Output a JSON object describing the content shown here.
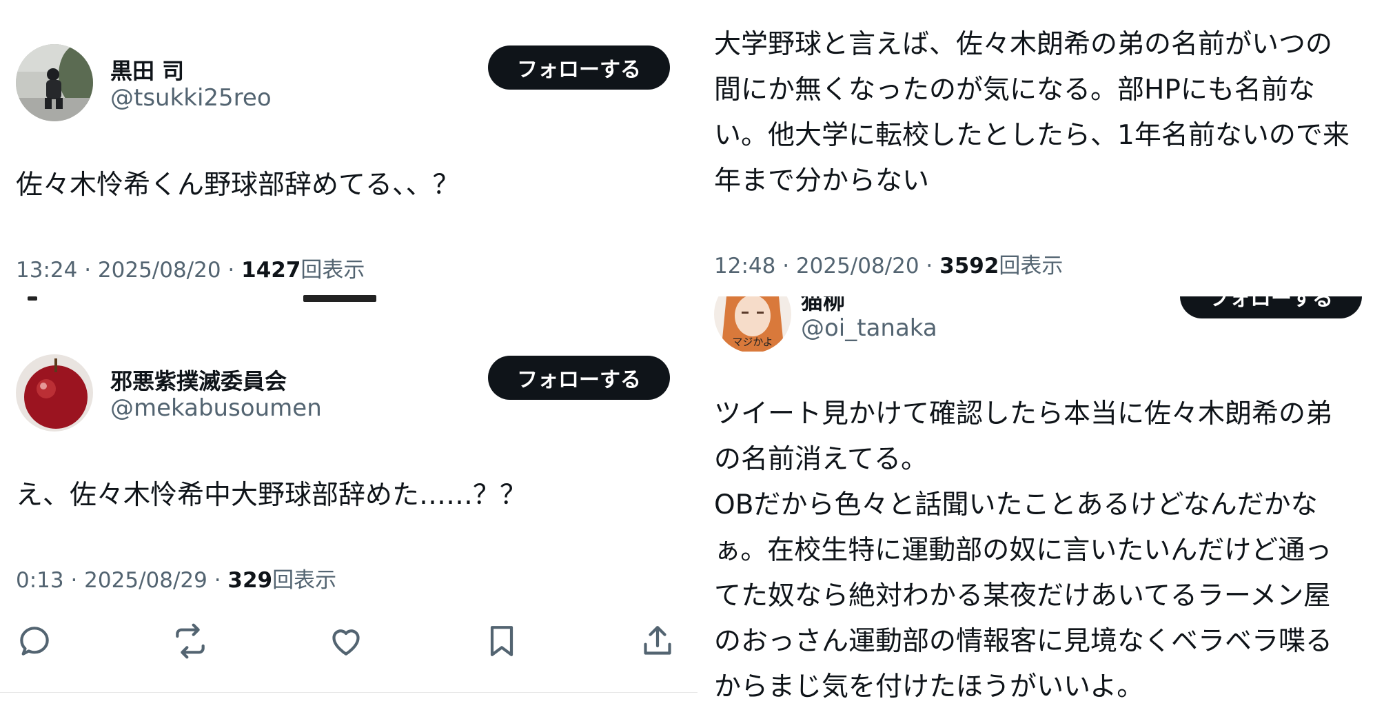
{
  "left": {
    "tweet1": {
      "name": "黒田 司",
      "handle": "@tsukki25reo",
      "follow_label": "フォローする",
      "text": "佐々木怜希くん野球部辞めてる、、？",
      "time": "13:24 · 2025/08/20 · ",
      "views": "1427",
      "views_suffix": "回表示"
    },
    "tweet2": {
      "name": "邪悪紫撲滅委員会",
      "handle": "@mekabusoumen",
      "follow_label": "フォローする",
      "text": "え、佐々木怜希中大野球部辞めた……？？",
      "time": "0:13 · 2025/08/29 · ",
      "views": "329",
      "views_suffix": "回表示"
    },
    "actions": [
      "reply-icon",
      "retweet-icon",
      "like-icon",
      "bookmark-icon",
      "share-icon"
    ]
  },
  "right": {
    "tweet3": {
      "lines": [
        "大学野球と言えば、佐々木朗希の弟の名前がいつの",
        "間にか無くなったのが気になる。部HPにも名前な",
        "い。他大学に転校したとしたら、1年名前ないので来",
        "年まで分からない"
      ],
      "time": "12:48 · 2025/08/20 · ",
      "views": "3592",
      "views_suffix": "回表示"
    },
    "tweet4": {
      "name": "猫柳",
      "handle": "@oi_tanaka",
      "follow_label": "フォローする",
      "avatar_caption": "マジかよ",
      "lines": [
        "ツイート見かけて確認したら本当に佐々木朗希の弟",
        "の名前消えてる。",
        "OBだから色々と話聞いたことあるけどなんだかな",
        "ぁ。在校生特に運動部の奴に言いたいんだけど通っ",
        "てた奴なら絶対わかる某夜だけあいてるラーメン屋",
        "のおっさん運動部の情報客に見境なくベラベラ喋る",
        "からまじ気を付けたほうがいいよ。"
      ]
    }
  }
}
